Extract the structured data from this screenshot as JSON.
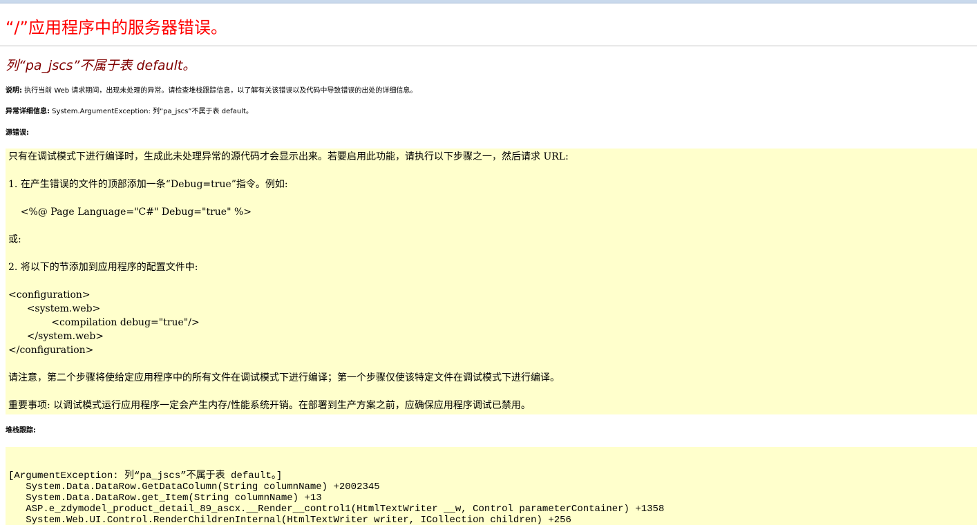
{
  "page": {
    "title": "“/”应用程序中的服务器错误。",
    "subtitle": "列“pa_jscs”不属于表 default。"
  },
  "description": {
    "label": "说明:",
    "text": " 执行当前 Web 请求期间，出现未处理的异常。请检查堆栈跟踪信息，以了解有关该错误以及代码中导致错误的出处的详细信息。"
  },
  "exception_details": {
    "label": "异常详细信息:",
    "text": " System.ArgumentException: 列“pa_jscs”不属于表 default。"
  },
  "source_error": {
    "label": "源错误:",
    "lines": [
      "只有在调试模式下进行编译时，生成此未处理异常的源代码才会显示出来。若要启用此功能，请执行以下步骤之一，然后请求 URL:",
      "",
      "1. 在产生错误的文件的顶部添加一条“Debug=true”指令。例如:",
      "",
      "    <%@ Page Language=\"C#\" Debug=\"true\" %>",
      "",
      "或:",
      "",
      "2. 将以下的节添加到应用程序的配置文件中:",
      "",
      "<configuration>",
      "      <system.web>",
      "              <compilation debug=\"true\"/>",
      "      </system.web>",
      "</configuration>",
      "",
      "请注意，第二个步骤将使给定应用程序中的所有文件在调试模式下进行编译；第一个步骤仅使该特定文件在调试模式下进行编译。",
      "",
      "重要事项: 以调试模式运行应用程序一定会产生内存/性能系统开销。在部署到生产方案之前，应确保应用程序调试已禁用。"
    ]
  },
  "stack_trace": {
    "label": "堆栈跟踪:",
    "lines": [
      "[ArgumentException: 列“pa_jscs”不属于表 default。]",
      "   System.Data.DataRow.GetDataColumn(String columnName) +2002345",
      "   System.Data.DataRow.get_Item(String columnName) +13",
      "   ASP.e_zdymodel_product_detail_89_ascx.__Render__control1(HtmlTextWriter __w, Control parameterContainer) +1358",
      "   System.Web.UI.Control.RenderChildrenInternal(HtmlTextWriter writer, ICollection children) +256"
    ]
  },
  "colors": {
    "title": "#ff0000",
    "subtitle": "#800000",
    "code_background": "#ffffcc"
  }
}
